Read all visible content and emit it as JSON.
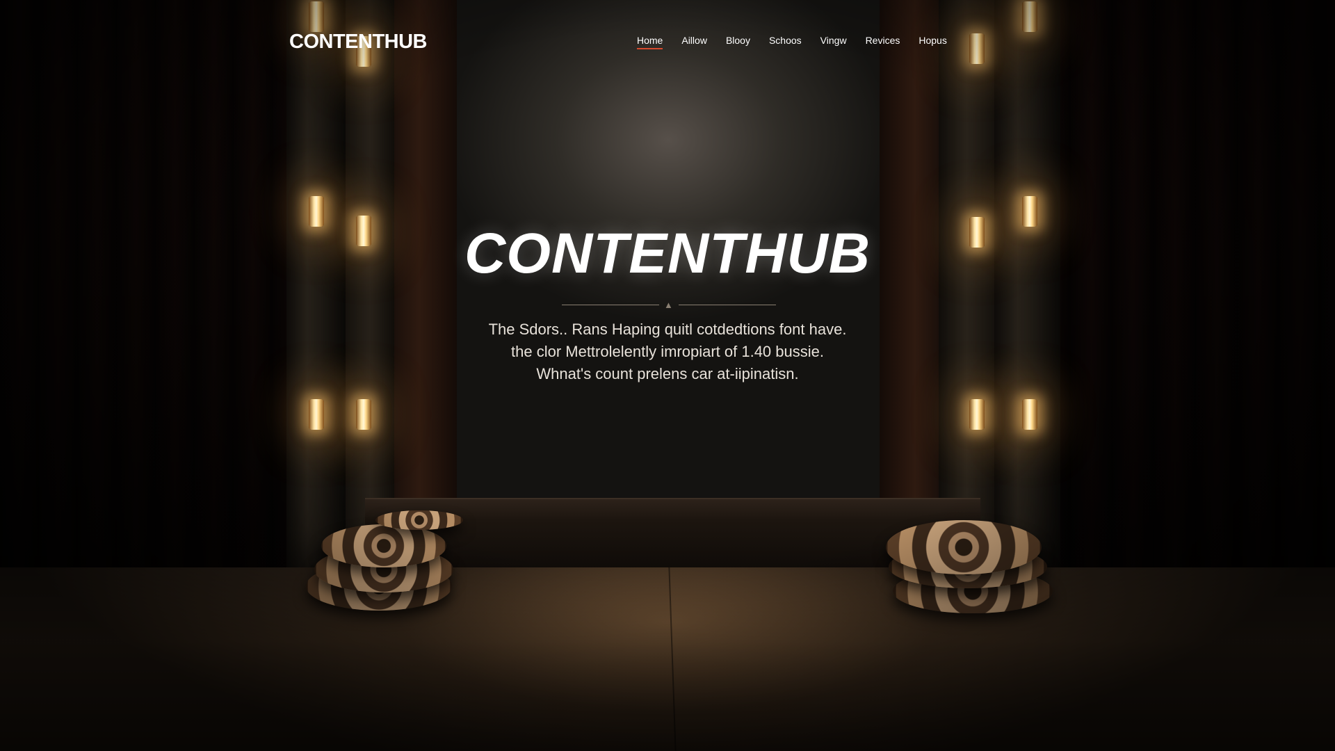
{
  "header": {
    "brand": "CONTENTHUB",
    "nav": [
      {
        "label": "Home",
        "active": true
      },
      {
        "label": "Aillow",
        "active": false
      },
      {
        "label": "Blooy",
        "active": false
      },
      {
        "label": "Schoos",
        "active": false
      },
      {
        "label": "Vingw",
        "active": false
      },
      {
        "label": "Revices",
        "active": false
      },
      {
        "label": "Hopus",
        "active": false
      }
    ]
  },
  "hero": {
    "title": "CONTENTHUB",
    "divider_icon": "flame-icon",
    "tagline_lines": [
      "The Sdors.. Rans Haping quitl cotdedtions font have.",
      "the clor Mettrolelently imropiart of 1.40 bussie.",
      "Whnat's count prelens car at-iipinatisn."
    ]
  },
  "colors": {
    "accent_underline": "#d84a2e",
    "text": "#ffffff",
    "light_glow": "#ffc46e"
  }
}
